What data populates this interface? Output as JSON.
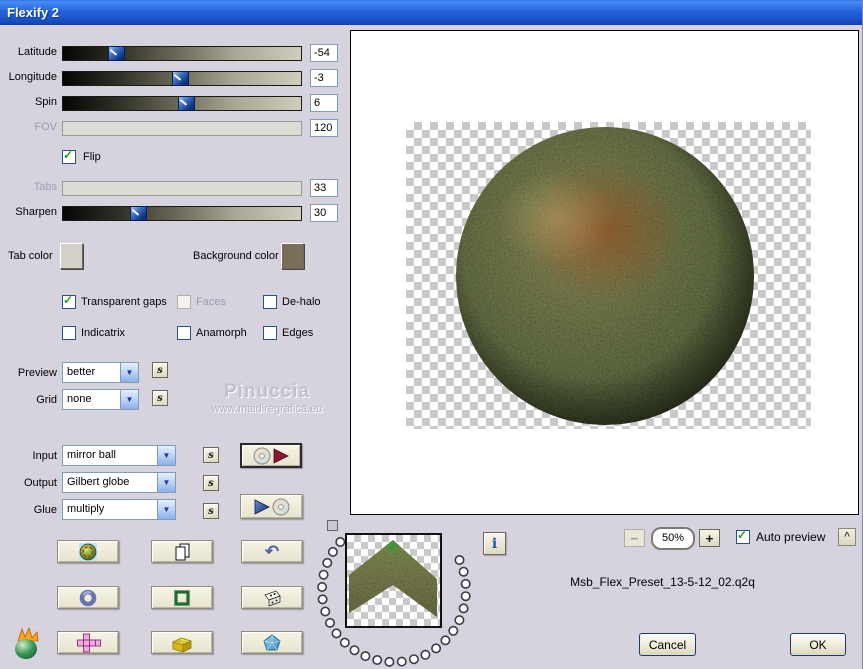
{
  "window": {
    "title": "Flexify 2"
  },
  "colors": {
    "titlebar": "#2563dd",
    "dialog_bg": "#d6d3df",
    "tab_color_swatch": "#d3d1c7",
    "background_color_swatch": "#7b6e58"
  },
  "panel": {
    "sliders": [
      {
        "label": "Latitude",
        "value": "-54",
        "enabled": true
      },
      {
        "label": "Longitude",
        "value": "-3",
        "enabled": true
      },
      {
        "label": "Spin",
        "value": "6",
        "enabled": true
      },
      {
        "label": "FOV",
        "value": "120",
        "enabled": false
      },
      {
        "label": "Tabs",
        "value": "33",
        "enabled": false
      },
      {
        "label": "Sharpen",
        "value": "30",
        "enabled": true
      }
    ],
    "flip": {
      "label": "Flip",
      "checked": true
    },
    "tab_color": {
      "label": "Tab color"
    },
    "background_color": {
      "label": "Background color"
    },
    "options": [
      {
        "label": "Transparent gaps",
        "checked": true,
        "enabled": true
      },
      {
        "label": "Faces",
        "checked": false,
        "enabled": false
      },
      {
        "label": "De-halo",
        "checked": false,
        "enabled": true
      },
      {
        "label": "Indicatrix",
        "checked": false,
        "enabled": true
      },
      {
        "label": "Anamorph",
        "checked": false,
        "enabled": true
      },
      {
        "label": "Edges",
        "checked": false,
        "enabled": true
      }
    ],
    "dropdowns": [
      {
        "label": "Preview",
        "value": "better"
      },
      {
        "label": "Grid",
        "value": "none"
      },
      {
        "label": "Input",
        "value": "mirror ball"
      },
      {
        "label": "Output",
        "value": "Gilbert globe"
      },
      {
        "label": "Glue",
        "value": "multiply"
      }
    ],
    "s_button": "s"
  },
  "watermark": {
    "line1": "Pinuccia",
    "line2": "www.maidiregrafica.eu"
  },
  "footer": {
    "zoom": {
      "minus": "−",
      "level": "50%",
      "plus": "+"
    },
    "auto_preview": {
      "label": "Auto preview",
      "checked": true
    },
    "preset_name": "Msb_Flex_Preset_13-5-12_02.q2q",
    "info_label": "i",
    "caret_label": "^",
    "cancel_label": "Cancel",
    "ok_label": "OK"
  }
}
